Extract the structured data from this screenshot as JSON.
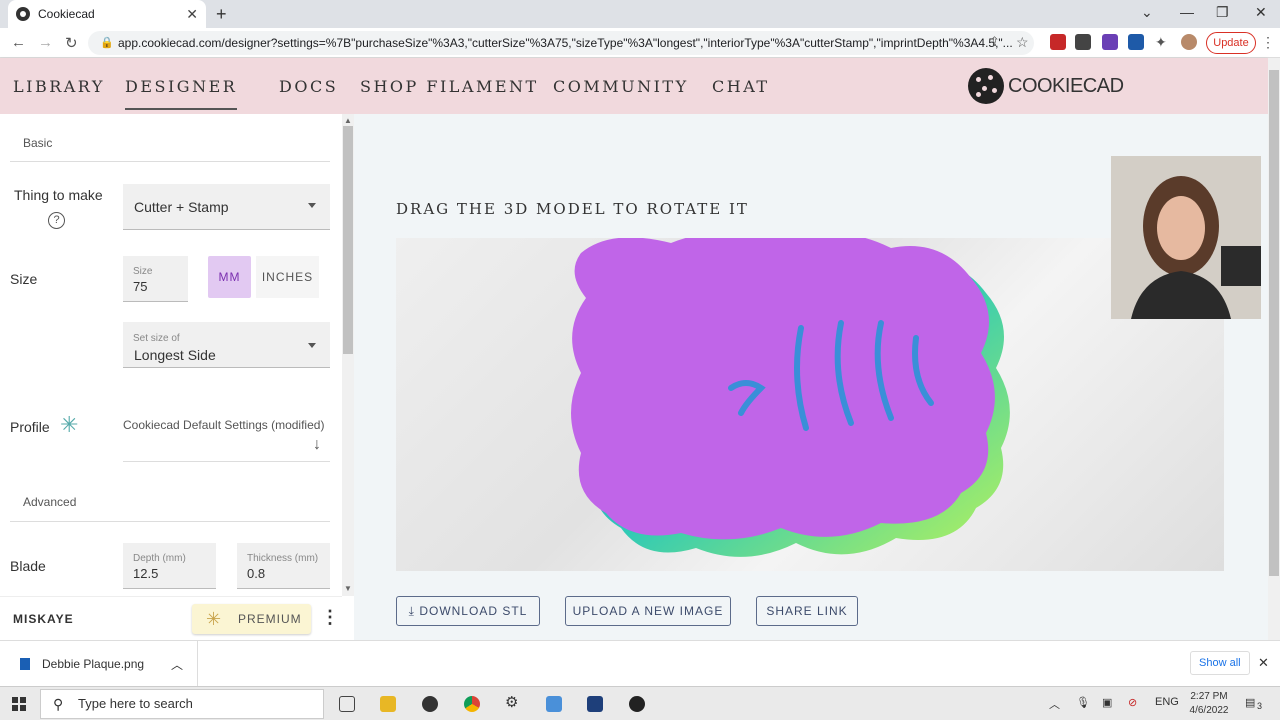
{
  "browser": {
    "tab_title": "Cookiecad",
    "url": "app.cookiecad.com/designer?settings=%7B\"purchaseSize\"%3A3,\"cutterSize\"%3A75,\"sizeType\"%3A\"longest\",\"interiorType\"%3A\"cutterStamp\",\"imprintDepth\"%3A4.5,\"...",
    "update_label": "Update"
  },
  "nav": {
    "library": "LIBRARY",
    "designer": "DESIGNER",
    "docs": "DOCS",
    "shop_filament": "SHOP FILAMENT",
    "community": "COMMUNITY",
    "chat": "CHAT",
    "logo_text": "COOKIECAD"
  },
  "panel": {
    "basic_label": "Basic",
    "thing_label": "Thing to make",
    "thing_value": "Cutter + Stamp",
    "size_label": "Size",
    "size_field_label": "Size",
    "size_value": "75",
    "unit_mm": "MM",
    "unit_inches": "INCHES",
    "setsize_label": "Set size of",
    "setsize_value": "Longest Side",
    "profile_label": "Profile",
    "profile_value": "Cookiecad Default Settings (modified)",
    "advanced_label": "Advanced",
    "blade_label": "Blade",
    "depth_label": "Depth (mm)",
    "depth_value": "12.5",
    "thickness_label": "Thickness (mm)",
    "thickness_value": "0.8"
  },
  "footer": {
    "username": "MISKAYE",
    "premium_label": "PREMIUM"
  },
  "main": {
    "drag_title": "DRAG THE 3D MODEL TO ROTATE IT",
    "download_label": "DOWNLOAD STL",
    "upload_label": "UPLOAD A NEW IMAGE",
    "share_label": "SHARE LINK"
  },
  "downloads": {
    "file_name": "Debbie Plaque.png",
    "show_all": "Show all"
  },
  "taskbar": {
    "search_placeholder": "Type here to search",
    "lang": "ENG",
    "time": "2:27 PM",
    "date": "4/6/2022",
    "notification_count": "3"
  },
  "colors": {
    "header_bg": "#f1d9dd",
    "model_purple": "#c065e8",
    "accent_unit": "#e2c9f2"
  }
}
